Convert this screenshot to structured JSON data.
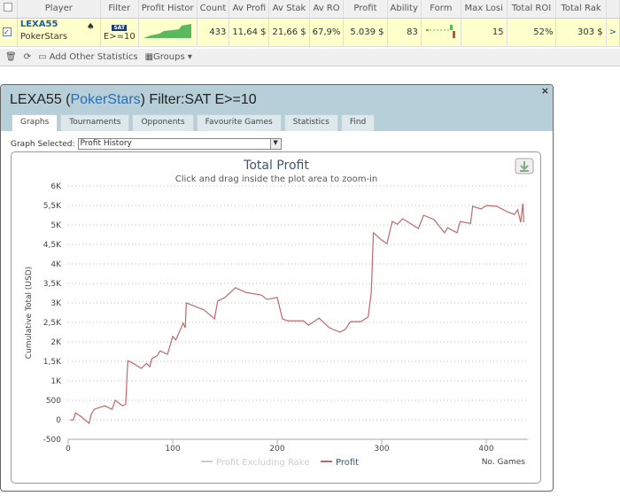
{
  "table": {
    "headers": [
      "",
      "Player",
      "Filter",
      "Profit Histor",
      "Count",
      "Av Profi",
      "Av Stak",
      "Av RO",
      "Profit",
      "Ability",
      "Form",
      "Max Losi",
      "Total ROI",
      "Total Rak"
    ],
    "row": {
      "checked": true,
      "player": "LEXA55",
      "site": "PokerStars",
      "filter_badge": "SAT",
      "filter": "E>=10",
      "count": "433",
      "av_profit": "11,64 $",
      "av_stake": "21,66 $",
      "av_roi": "67,9%",
      "profit": "5.039 $",
      "ability": "83",
      "max_losing": "15",
      "total_roi": "52%",
      "total_rake": "303 $",
      "more": ">"
    }
  },
  "toolbar": {
    "add_stats": "Add Other Statistics",
    "groups": "Groups"
  },
  "dialog": {
    "player": "LEXA55",
    "open_paren": " (",
    "site": "PokerStars",
    "filter_text": ") Filter:SAT E>=10",
    "close": "×",
    "tabs": [
      "Graphs",
      "Tournaments",
      "Opponents",
      "Favourite Games",
      "Statistics",
      "Find"
    ],
    "graph_selected_label": "Graph Selected:",
    "graph_selected": "Profit History"
  },
  "colors": {
    "profit_line": "#c0696b",
    "header_bg": "#b6cfd8",
    "row_bg": "#ffffcc",
    "sparkline": "#5cb85c"
  },
  "chart_data": {
    "type": "line",
    "title": "Total Profit",
    "subtitle": "Click and drag inside the plot area to zoom-in",
    "xlabel": "No. Games",
    "ylabel": "Cumulative Total (USD)",
    "xlim": [
      0,
      440
    ],
    "ylim": [
      -500,
      6000
    ],
    "xticks": [
      "0",
      "100",
      "200",
      "300",
      "400"
    ],
    "yticks": [
      "-500",
      "0",
      "500",
      "1K",
      "1,5K",
      "2K",
      "2,5K",
      "3K",
      "3,5K",
      "4K",
      "4,5K",
      "5K",
      "5,5K",
      "6K"
    ],
    "grid": true,
    "legend": "bottom",
    "series": [
      {
        "name": "Profit Excluding Rake",
        "visible": false,
        "color": "#cccccc"
      },
      {
        "name": "Profit",
        "color": "#c0696b",
        "x": [
          2,
          5,
          7,
          12,
          20,
          22,
          25,
          30,
          35,
          42,
          45,
          52,
          55,
          57,
          62,
          70,
          75,
          78,
          80,
          85,
          88,
          95,
          100,
          103,
          110,
          112,
          113,
          130,
          140,
          143,
          150,
          160,
          170,
          185,
          190,
          200,
          205,
          210,
          225,
          230,
          240,
          250,
          260,
          265,
          270,
          280,
          287,
          290,
          292,
          300,
          305,
          310,
          315,
          320,
          335,
          340,
          350,
          360,
          363,
          372,
          375,
          385,
          387,
          395,
          400,
          410,
          420,
          427,
          430,
          433,
          435,
          436
        ],
        "y": [
          0,
          0,
          180,
          90,
          -90,
          140,
          270,
          320,
          360,
          270,
          500,
          360,
          400,
          1520,
          1450,
          1320,
          1450,
          1360,
          1570,
          1640,
          1770,
          1680,
          2140,
          2050,
          2480,
          2360,
          3000,
          2820,
          2590,
          3050,
          3140,
          3390,
          3270,
          3200,
          3090,
          3140,
          2590,
          2540,
          2540,
          2430,
          2610,
          2360,
          2250,
          2320,
          2520,
          2520,
          2640,
          3270,
          4800,
          4610,
          4520,
          5090,
          5020,
          5160,
          4910,
          5250,
          5140,
          4800,
          4930,
          4800,
          5090,
          5040,
          5480,
          5410,
          5500,
          5480,
          5340,
          5270,
          5390,
          5070,
          5550,
          5070
        ]
      }
    ]
  }
}
